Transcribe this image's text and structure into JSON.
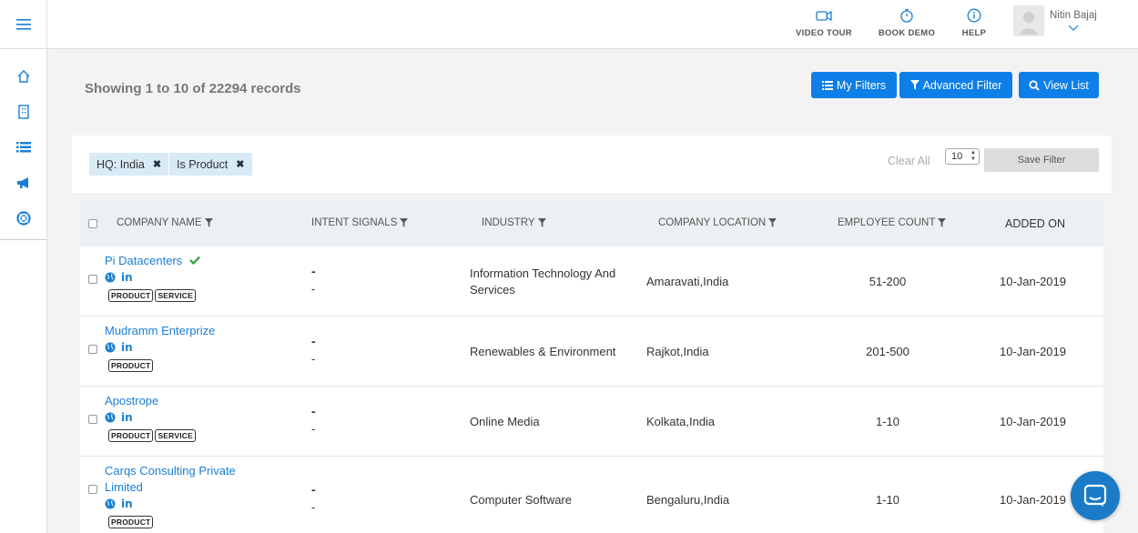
{
  "topbar": {
    "video_tour": "VIDEO TOUR",
    "book_demo": "BOOK DEMO",
    "help": "HELP",
    "user_name": "Nitin Bajaj"
  },
  "header": {
    "records_text": "Showing 1 to 10 of 22294 records",
    "my_filters": "My Filters",
    "advanced_filter": "Advanced Filter",
    "view_list": "View List"
  },
  "filters": {
    "chips": [
      "HQ: India",
      "Is Product"
    ],
    "clear_all": "Clear All",
    "per_page": "10",
    "save_filter": "Save Filter"
  },
  "table": {
    "columns": [
      "COMPANY NAME",
      "INTENT SIGNALS",
      "INDUSTRY",
      "COMPANY LOCATION",
      "EMPLOYEE COUNT",
      "ADDED ON"
    ],
    "rows": [
      {
        "name": "Pi Datacenters",
        "verified": true,
        "tags": [
          "PRODUCT",
          "SERVICE"
        ],
        "intent1": "-",
        "intent2": "-",
        "industry": "Information Technology And Services",
        "location": "Amaravati,India",
        "employees": "51-200",
        "added_on": "10-Jan-2019"
      },
      {
        "name": "Mudramm Enterprize",
        "verified": false,
        "tags": [
          "PRODUCT"
        ],
        "intent1": "-",
        "intent2": "-",
        "industry": "Renewables & Environment",
        "location": "Rajkot,India",
        "employees": "201-500",
        "added_on": "10-Jan-2019"
      },
      {
        "name": "Apostrope",
        "verified": false,
        "tags": [
          "PRODUCT",
          "SERVICE"
        ],
        "intent1": "-",
        "intent2": "-",
        "industry": "Online Media",
        "location": "Kolkata,India",
        "employees": "1-10",
        "added_on": "10-Jan-2019"
      },
      {
        "name": "Carqs Consulting Private Limited",
        "verified": false,
        "tags": [
          "PRODUCT"
        ],
        "intent1": "-",
        "intent2": "-",
        "industry": "Computer Software",
        "location": "Bengaluru,India",
        "employees": "1-10",
        "added_on": "10-Jan-2019"
      }
    ]
  },
  "colors": {
    "accent": "#0d7fe6",
    "link": "#1a7fd4",
    "verified": "#2e9b3a",
    "chip_bg": "#d9eaf7"
  }
}
